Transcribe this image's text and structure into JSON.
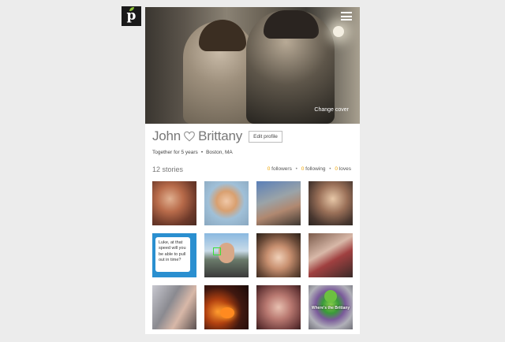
{
  "header": {
    "logo_letter": "p",
    "cover_action": "Change cover"
  },
  "profile": {
    "name_left": "John",
    "name_right": "Brittany",
    "edit_label": "Edit profile",
    "together": "Together for 5 years",
    "location": "Boston, MA"
  },
  "stories": {
    "count_label": "12 stories",
    "followers_count": "0",
    "followers_label": "followers",
    "following_count": "0",
    "following_label": "following",
    "loves_count": "0",
    "loves_label": "loves"
  },
  "tiles": {
    "quote": "Luke, at that speed will you be able to pull out in time?",
    "monster_text": "Where's the Brittany"
  },
  "colors": {
    "accent": "#f0a500",
    "quote_tile": "#2a8fd0",
    "logo_leaf": "#8ec33a"
  },
  "icons": [
    "menu-icon",
    "heart-icon",
    "logo-icon"
  ]
}
